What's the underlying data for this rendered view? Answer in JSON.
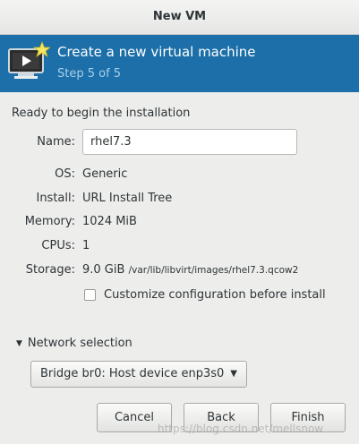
{
  "window": {
    "title": "New VM"
  },
  "banner": {
    "heading": "Create a new virtual machine",
    "step": "Step 5 of 5"
  },
  "summary": {
    "ready": "Ready to begin the installation",
    "name_label": "Name:",
    "name_value": "rhel7.3",
    "os_label": "OS:",
    "os_value": "Generic",
    "install_label": "Install:",
    "install_value": "URL Install Tree",
    "memory_label": "Memory:",
    "memory_value": "1024 MiB",
    "cpus_label": "CPUs:",
    "cpus_value": "1",
    "storage_label": "Storage:",
    "storage_size": "9.0 GiB",
    "storage_path": "/var/lib/libvirt/images/rhel7.3.qcow2"
  },
  "customize": {
    "label": "Customize configuration before install",
    "checked": false
  },
  "network": {
    "expander_label": "Network selection",
    "selected": "Bridge br0: Host device enp3s0"
  },
  "buttons": {
    "cancel": "Cancel",
    "back": "Back",
    "finish": "Finish"
  },
  "watermark": "https://blog.csdn.net/mellsnow",
  "icons": {
    "vm": "vm-monitor-icon",
    "expander": "triangle-down-icon",
    "combo": "caret-down-icon"
  }
}
